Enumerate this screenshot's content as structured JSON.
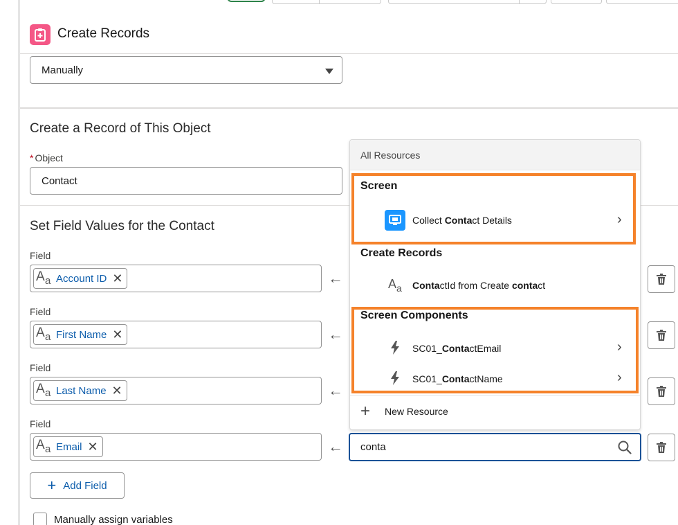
{
  "header": {
    "title": "Create Records",
    "icon": "create-records-icon"
  },
  "record_select": {
    "value": "Manually"
  },
  "object_section": {
    "title": "Create a Record of This Object",
    "object_label": "Object",
    "required_mark": "*",
    "object_value": "Contact"
  },
  "fields_section": {
    "title": "Set Field Values for the Contact",
    "rows": [
      {
        "label": "Field",
        "pill": "Account ID"
      },
      {
        "label": "Field",
        "pill": "First Name"
      },
      {
        "label": "Field",
        "pill": "Last Name"
      },
      {
        "label": "Field",
        "pill": "Email"
      }
    ],
    "add_field_label": "Add Field",
    "manual_assign_label": "Manually assign variables"
  },
  "resource_search": {
    "value": "conta"
  },
  "dropdown": {
    "header": "All Resources",
    "groups": [
      {
        "name": "Screen",
        "items": [
          {
            "pre": "Collect ",
            "bold": "Conta",
            "post": "ct Details"
          }
        ]
      },
      {
        "name": "Create Records",
        "items": [
          {
            "bold1": "Conta",
            "mid": "ctId from Create ",
            "bold2": "conta",
            "post": "ct"
          }
        ]
      },
      {
        "name": "Screen Components",
        "items": [
          {
            "pre": "SC01_",
            "bold": "Conta",
            "post": "ctEmail"
          },
          {
            "pre": "SC01_",
            "bold": "Conta",
            "post": "ctName"
          }
        ]
      }
    ],
    "new_resource_label": "New Resource"
  },
  "colors": {
    "highlight": "#f5822a",
    "accent": "#0b5cab",
    "focus": "#1b5297",
    "header_icon": "#f45786",
    "screen_icon": "#1b96ff"
  }
}
